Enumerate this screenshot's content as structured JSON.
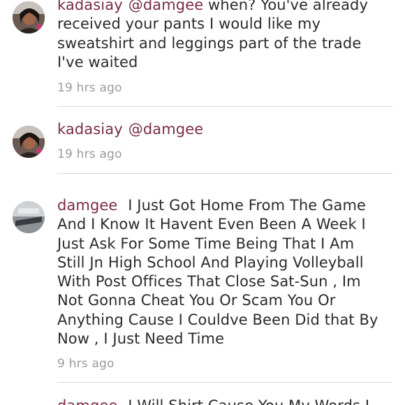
{
  "comments": [
    {
      "username": "kadasiay",
      "mention": "@damgee",
      "text": "when? You've already received your pants I would like my sweatshirt and leggings part of the trade I've waited",
      "time": "19 hrs ago"
    },
    {
      "username": "kadasiay",
      "mention": "@damgee",
      "text": "",
      "time": "19 hrs ago"
    },
    {
      "username": "damgee",
      "mention": "",
      "text": "I Just Got Home From The Game And I Know It Havent Even Been A Week I Just Ask For Some Time Being That I Am Still Jn High School And Playing Volleyball With Post Offices That Close Sat-Sun , Im Not Gonna Cheat You Or Scam You Or Anything Cause I Couldve Been Did that By Now , I Just Need Time",
      "time": "9 hrs ago"
    },
    {
      "username": "damgee",
      "mention": "",
      "text": "I Will Shirt Cause You My Words I",
      "time": ""
    }
  ],
  "colors": {
    "username": "#7a2d41",
    "timestamp": "#9a9a9a",
    "divider": "#d8d8d8"
  }
}
